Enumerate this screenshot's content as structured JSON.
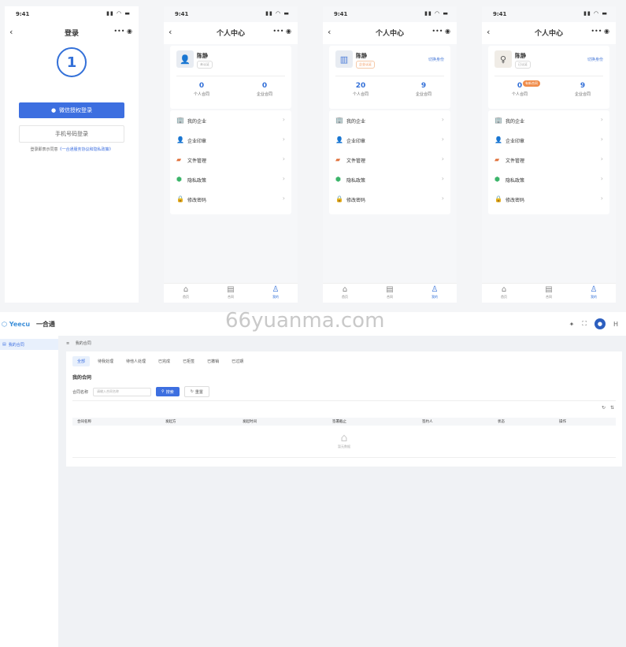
{
  "status_time": "9:41",
  "login": {
    "title": "登录",
    "wechat_btn": "微信授权登录",
    "phone_btn": "手机号码登录",
    "agree_prefix": "登录即表示同意",
    "agree_link": "《一合通服务协议和隐私政策》"
  },
  "profile": {
    "title": "个人中心",
    "name": "陈静",
    "badge1": "未认证",
    "badge2": "企业认证",
    "badge3": "已认证",
    "switch_label": "切换身份",
    "stat_personal_label": "个人合同",
    "stat_company_label": "企业合同",
    "screens": [
      {
        "personal": "0",
        "company": "0"
      },
      {
        "personal": "20",
        "company": "9"
      },
      {
        "personal": "0",
        "company": "9"
      }
    ],
    "new_tag": "有新合同",
    "menu": [
      "我的企业",
      "企业印章",
      "文件管理",
      "隐私政策",
      "修改密码"
    ],
    "tabs": [
      "首页",
      "合同",
      "我的"
    ]
  },
  "desktop": {
    "brand": "Yeecu",
    "brand_sub": "一合通",
    "watermark": "66yuanma.com",
    "user": "H",
    "sidebar_item": "我的合同",
    "breadcrumb": "我的合同",
    "tabs": [
      "全部",
      "待我处理",
      "待他人处理",
      "已完成",
      "已拒签",
      "已撤销",
      "已过期"
    ],
    "section": "我的合同",
    "filter_label": "合同名称",
    "filter_placeholder": "请输入合同名称",
    "search_btn": "搜索",
    "reset_btn": "重置",
    "columns": [
      "合同名称",
      "发起方",
      "发起时间",
      "签署截止",
      "签约人",
      "状态",
      "操作"
    ],
    "empty": "暂无数据"
  },
  "colors": {
    "primary": "#3d6fe0",
    "accent_orange": "#f08c4a"
  }
}
